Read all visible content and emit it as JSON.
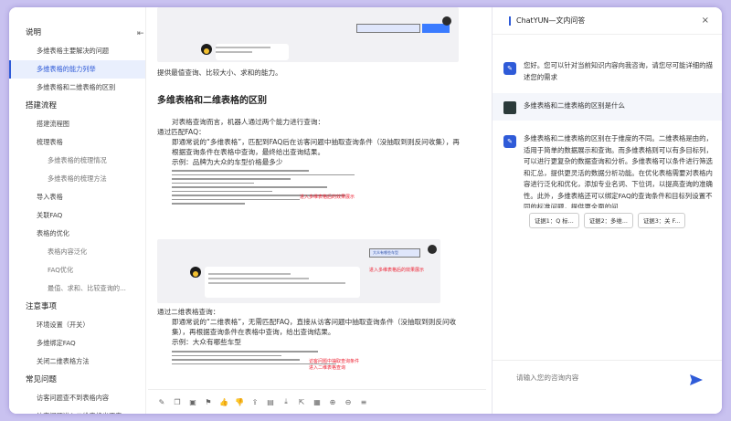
{
  "sidebar": {
    "collapse_glyph": "⇤",
    "items": [
      {
        "label": "说明",
        "level": "h",
        "active": false
      },
      {
        "label": "多维表格主要解决的问题",
        "level": "l2",
        "active": false
      },
      {
        "label": "多维表格的能力列举",
        "level": "l2",
        "active": true
      },
      {
        "label": "多维表格和二维表格的区别",
        "level": "l2",
        "active": false
      },
      {
        "label": "搭建流程",
        "level": "h",
        "active": false
      },
      {
        "label": "搭建流程图",
        "level": "l2",
        "active": false
      },
      {
        "label": "梳理表格",
        "level": "l2",
        "active": false
      },
      {
        "label": "多维表格的梳理情况",
        "level": "l3",
        "active": false
      },
      {
        "label": "多维表格的梳理方法",
        "level": "l3",
        "active": false
      },
      {
        "label": "导入表格",
        "level": "l2",
        "active": false
      },
      {
        "label": "关联FAQ",
        "level": "l2",
        "active": false
      },
      {
        "label": "表格的优化",
        "level": "l2",
        "active": false
      },
      {
        "label": "表格内容泛化",
        "level": "l3",
        "active": false
      },
      {
        "label": "FAQ优化",
        "level": "l3",
        "active": false
      },
      {
        "label": "最值、求和、比较查询的...",
        "level": "l3",
        "active": false
      },
      {
        "label": "注意事项",
        "level": "h",
        "active": false
      },
      {
        "label": "环境设置（开关）",
        "level": "l2",
        "active": false
      },
      {
        "label": "多维绑定FAQ",
        "level": "l2",
        "active": false
      },
      {
        "label": "关闭二维表格方法",
        "level": "l2",
        "active": false
      },
      {
        "label": "常见问题",
        "level": "h",
        "active": false
      },
      {
        "label": "访客问题查不到表格内容",
        "level": "l2",
        "active": false
      },
      {
        "label": "访客问题进入二维表格出不来",
        "level": "l2",
        "active": false
      }
    ]
  },
  "doc": {
    "intro_line": "提供最值查询、比较大小、求和的能力。",
    "heading": "多维表格和二维表格的区别",
    "p1": "对表格查询而言，机器人通过两个能力进行查询：",
    "p2": "通过匹配FAQ：",
    "p3": "即通常说的“多维表格”，匹配到FAQ后在访客问题中抽取查询条件（没抽取到则反问收集），再根据查询条件在表格中查询，最终给出查询结果。",
    "p4": "示例：品牌为大众的车型价格最多少",
    "p5": "通过二维表格查询：",
    "p6": "即通常说的“二维表格”，无需匹配FAQ，直接从访客问题中抽取查询条件（没抽取到则反问收集），再根据查询条件在表格中查询，给出查询结果。",
    "p7": "示例：大众有哪些车型",
    "shot1_label": "大众有哪些车型",
    "shot2_red": "进入多维表格后的效果展示",
    "shot3_red": "访客问题中抽取查询条件",
    "shot3_red2": "进入二维表格查询"
  },
  "toolbar": {
    "icons": [
      "edit-icon",
      "copy-icon",
      "save-icon",
      "bookmark-icon",
      "thumb-up-icon",
      "thumb-down-icon",
      "share-icon",
      "folder-icon",
      "download-icon",
      "export-icon",
      "image-icon",
      "zoom-in-icon",
      "zoom-out-icon",
      "more-icon"
    ],
    "glyphs": [
      "✎",
      "❐",
      "▣",
      "⚑",
      "👍",
      "👎",
      "⇪",
      "▤",
      "⤓",
      "⇱",
      "▦",
      "⊕",
      "⊖",
      "≡"
    ]
  },
  "chat": {
    "title": "ChatYUN—文内问答",
    "close_glyph": "×",
    "bot_greeting": "您好。您可以针对当前知识内容向我咨询，请您尽可能详细的描述您的需求",
    "user_question": "多维表格和二维表格的区别是什么",
    "bot_answer": "多维表格和二维表格的区别在于维度的不同。二维表格是由的，适用于简单的数据展示和查询。而多维表格则可以有多目标列，可以进行更复杂的数据查询和分析。多维表格可以条件进行筛选和汇总，提供更灵活的数据分析功能。在优化表格需要对表格内容进行泛化和优化，添加专业名词、下位词，以提高查询的准确性。此外，多维表格还可以绑定FAQ的查询条件和目标列设置不同的标准问题，提供更全面的问",
    "chips": [
      "证据1：Q 标...",
      "证据2：多维...",
      "证据3：关 F..."
    ],
    "input_placeholder": "请输入您的咨询内容"
  },
  "colors": {
    "accent": "#2f5bd8",
    "frame_bg": "#c9c2f0",
    "active_bg": "#e9effd"
  }
}
